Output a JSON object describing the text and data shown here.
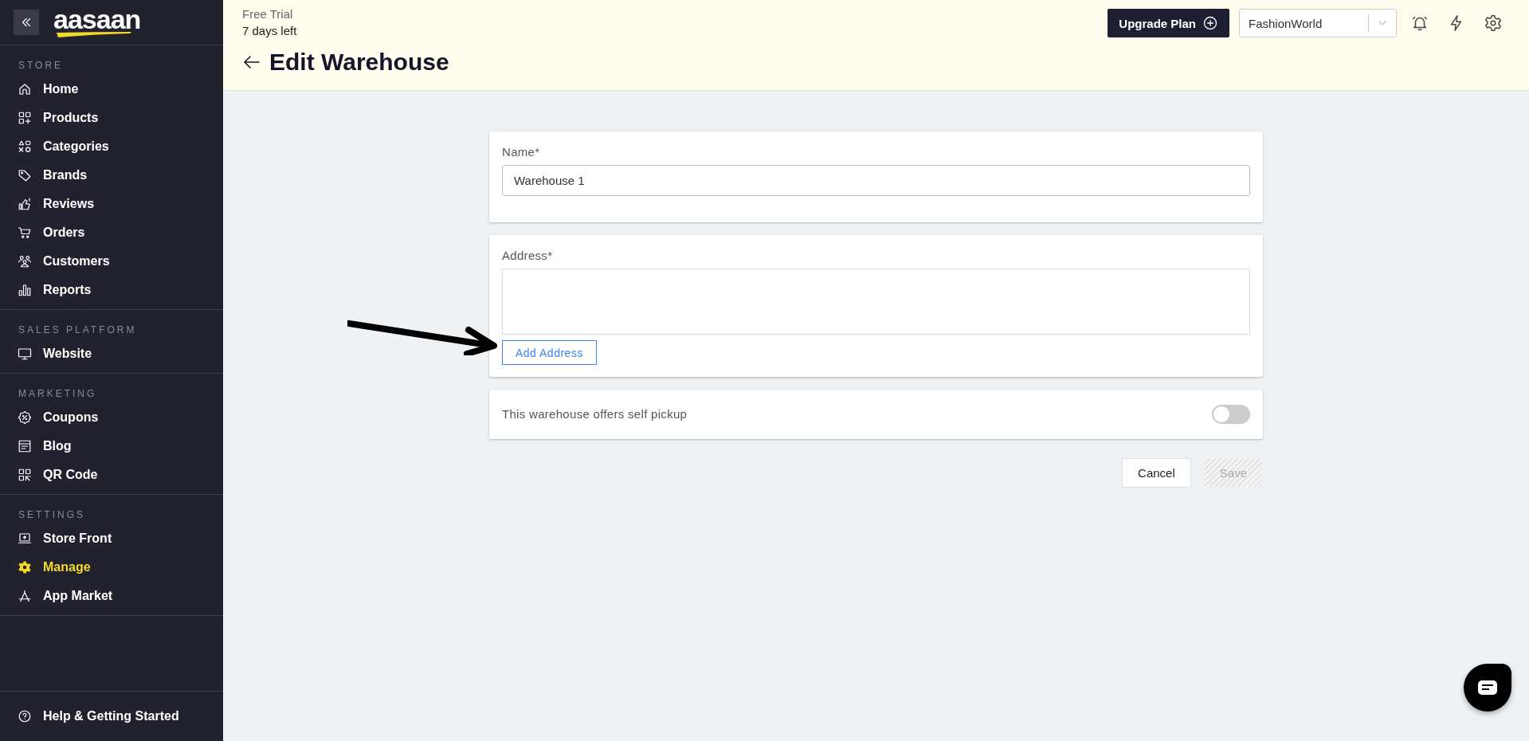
{
  "sidebar": {
    "logo": "aasaan",
    "sections": [
      {
        "title": "STORE",
        "items": [
          {
            "label": "Home",
            "selected": false
          },
          {
            "label": "Products",
            "selected": false
          },
          {
            "label": "Categories",
            "selected": false
          },
          {
            "label": "Brands",
            "selected": false
          },
          {
            "label": "Reviews",
            "selected": false
          },
          {
            "label": "Orders",
            "selected": false
          },
          {
            "label": "Customers",
            "selected": false
          },
          {
            "label": "Reports",
            "selected": false
          }
        ]
      },
      {
        "title": "SALES PLATFORM",
        "items": [
          {
            "label": "Website",
            "selected": false
          }
        ]
      },
      {
        "title": "MARKETING",
        "items": [
          {
            "label": "Coupons",
            "selected": false
          },
          {
            "label": "Blog",
            "selected": false
          },
          {
            "label": "QR Code",
            "selected": false
          }
        ]
      },
      {
        "title": "SETTINGS",
        "items": [
          {
            "label": "Store Front",
            "selected": false
          },
          {
            "label": "Manage",
            "selected": true
          },
          {
            "label": "App Market",
            "selected": false
          }
        ]
      }
    ],
    "footer_item": {
      "label": "Help & Getting Started"
    }
  },
  "header": {
    "trial_label": "Free Trial",
    "trial_remaining": "7 days left",
    "title": "Edit Warehouse",
    "upgrade_button": "Upgrade Plan",
    "store_select": {
      "value": "FashionWorld"
    }
  },
  "form": {
    "name": {
      "label": "Name*",
      "value": "Warehouse 1"
    },
    "address": {
      "label": "Address*",
      "button": "Add Address"
    },
    "self_pickup": {
      "label": "This warehouse offers self pickup",
      "on": false
    },
    "actions": [
      {
        "label": "Cancel",
        "disabled": false
      },
      {
        "label": "Save",
        "disabled": true
      }
    ]
  }
}
